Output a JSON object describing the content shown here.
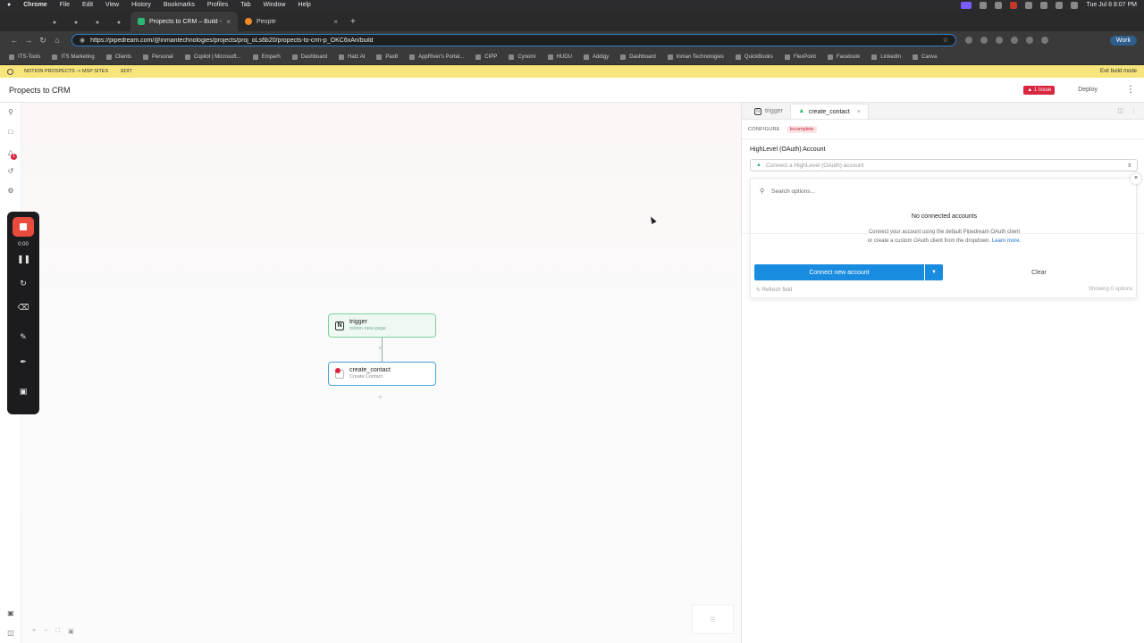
{
  "menubar": {
    "app": "Chrome",
    "items": [
      "File",
      "Edit",
      "View",
      "History",
      "Bookmarks",
      "Profiles",
      "Tab",
      "Window",
      "Help"
    ],
    "clock": "Tue Jul 8  8:07 PM"
  },
  "tabs": [
    {
      "label": "Propects to CRM – Build - Pip",
      "active": true
    },
    {
      "label": "People",
      "active": false
    }
  ],
  "address": {
    "url": "https://pipedream.com/@inmantechnologies/projects/proj_oLs6b20/propects-to-crm-p_OKC6xAn/build",
    "profile": "Work"
  },
  "bookmarks": [
    "ITS-Tools",
    "ITS Marketing",
    "Clients",
    "Personal",
    "Copilot | Microsoft...",
    "Emparh",
    "Dashboard",
    "Hatz AI",
    "Pax8",
    "AppRiver's Portal...",
    "CIPP",
    "Cynomi",
    "HUDU",
    "Addigy",
    "Dashboard",
    "Inman Technologies",
    "QuickBooks",
    "FlexPoint",
    "Facebook",
    "LinkedIn",
    "Canva"
  ],
  "banner": {
    "crumbs": [
      "NOTION PROSPECTS -> MSP SITES",
      "EDIT"
    ],
    "exit": "Exit build mode"
  },
  "header": {
    "title": "Propects to CRM",
    "issues": "1 Issue",
    "deploy": "Deploy"
  },
  "rail": {
    "notify_count": "1"
  },
  "recorder": {
    "time": "0:00"
  },
  "workflow": {
    "nodes": [
      {
        "title": "trigger",
        "subtitle": "notion-new-page"
      },
      {
        "title": "create_contact",
        "subtitle": "Create Contact"
      }
    ]
  },
  "panel": {
    "tabs": [
      {
        "label": "trigger"
      },
      {
        "label": "create_contact"
      }
    ],
    "configure_label": "CONFIGURE",
    "status": "Incomplete",
    "field_label": "HighLevel (OAuth) Account",
    "select_placeholder": "Connect a HighLevel (OAuth) account",
    "dropdown": {
      "search_placeholder": "Search options...",
      "empty_title": "No connected accounts",
      "help_line1": "Connect your account using the default Pipedream OAuth client",
      "help_line2": "or create a custom OAuth client from the dropdown.",
      "learn_more": "Learn more.",
      "connect_button": "Connect new account",
      "clear_button": "Clear",
      "refresh": "Refresh field",
      "showing": "Showing 0 options"
    }
  },
  "colors": {
    "accent_blue": "#1a8ce0",
    "issue_red": "#d9263e",
    "banner_yellow": "#f7e47a",
    "trigger_green": "#7fcf9c"
  }
}
